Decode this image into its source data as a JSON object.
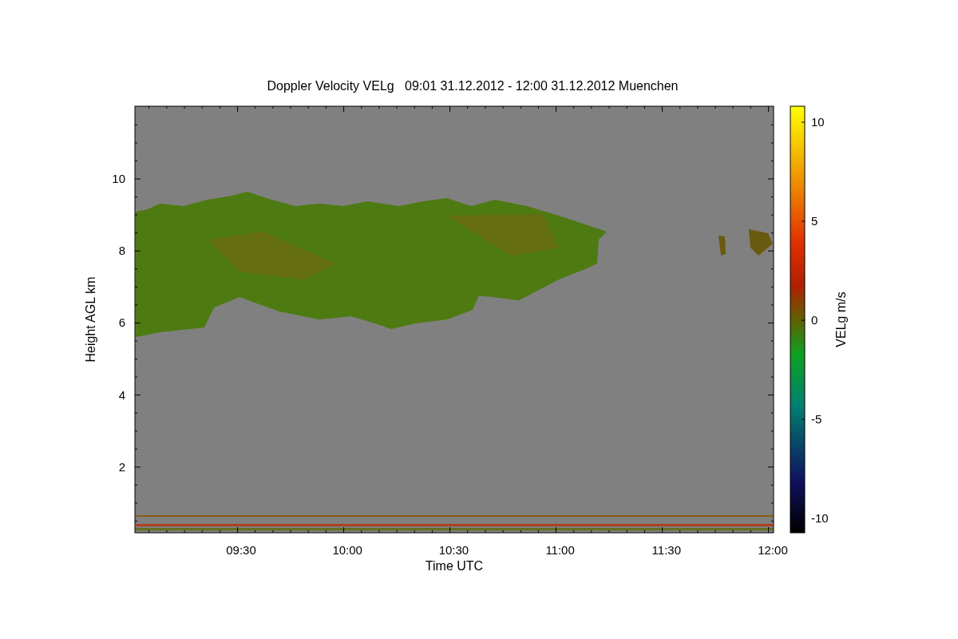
{
  "title": "Doppler Velocity VELg   09:01 31.12.2012 - 12:00 31.12.2012 Muenchen",
  "y_axis": {
    "label": "Height AGL km",
    "ticks": [
      "10",
      "8",
      "6",
      "4",
      "2"
    ]
  },
  "x_axis": {
    "label": "Time UTC",
    "ticks": [
      "09:30",
      "10:00",
      "10:30",
      "11:00",
      "11:30",
      "12:00"
    ]
  },
  "colorbar": {
    "label": "VELg m/s",
    "ticks": [
      "10",
      "5",
      "0",
      "-5",
      "-10"
    ]
  }
}
